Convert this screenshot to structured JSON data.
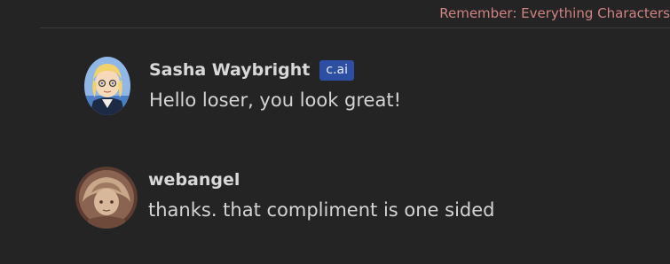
{
  "banner": {
    "text": "Remember: Everything Characters"
  },
  "messages": [
    {
      "author": "Sasha Waybright",
      "badge": "c.ai",
      "text": "Hello loser, you look great!",
      "avatar_icon": "character-avatar"
    },
    {
      "author": "webangel",
      "text": "thanks. that compliment is one sided",
      "avatar_icon": "user-avatar"
    }
  ],
  "colors": {
    "background": "#242424",
    "banner_text": "#cf8480",
    "badge_bg": "#2d4fa3",
    "author_text": "#d8d8d8",
    "message_text": "#d4d4d4"
  }
}
